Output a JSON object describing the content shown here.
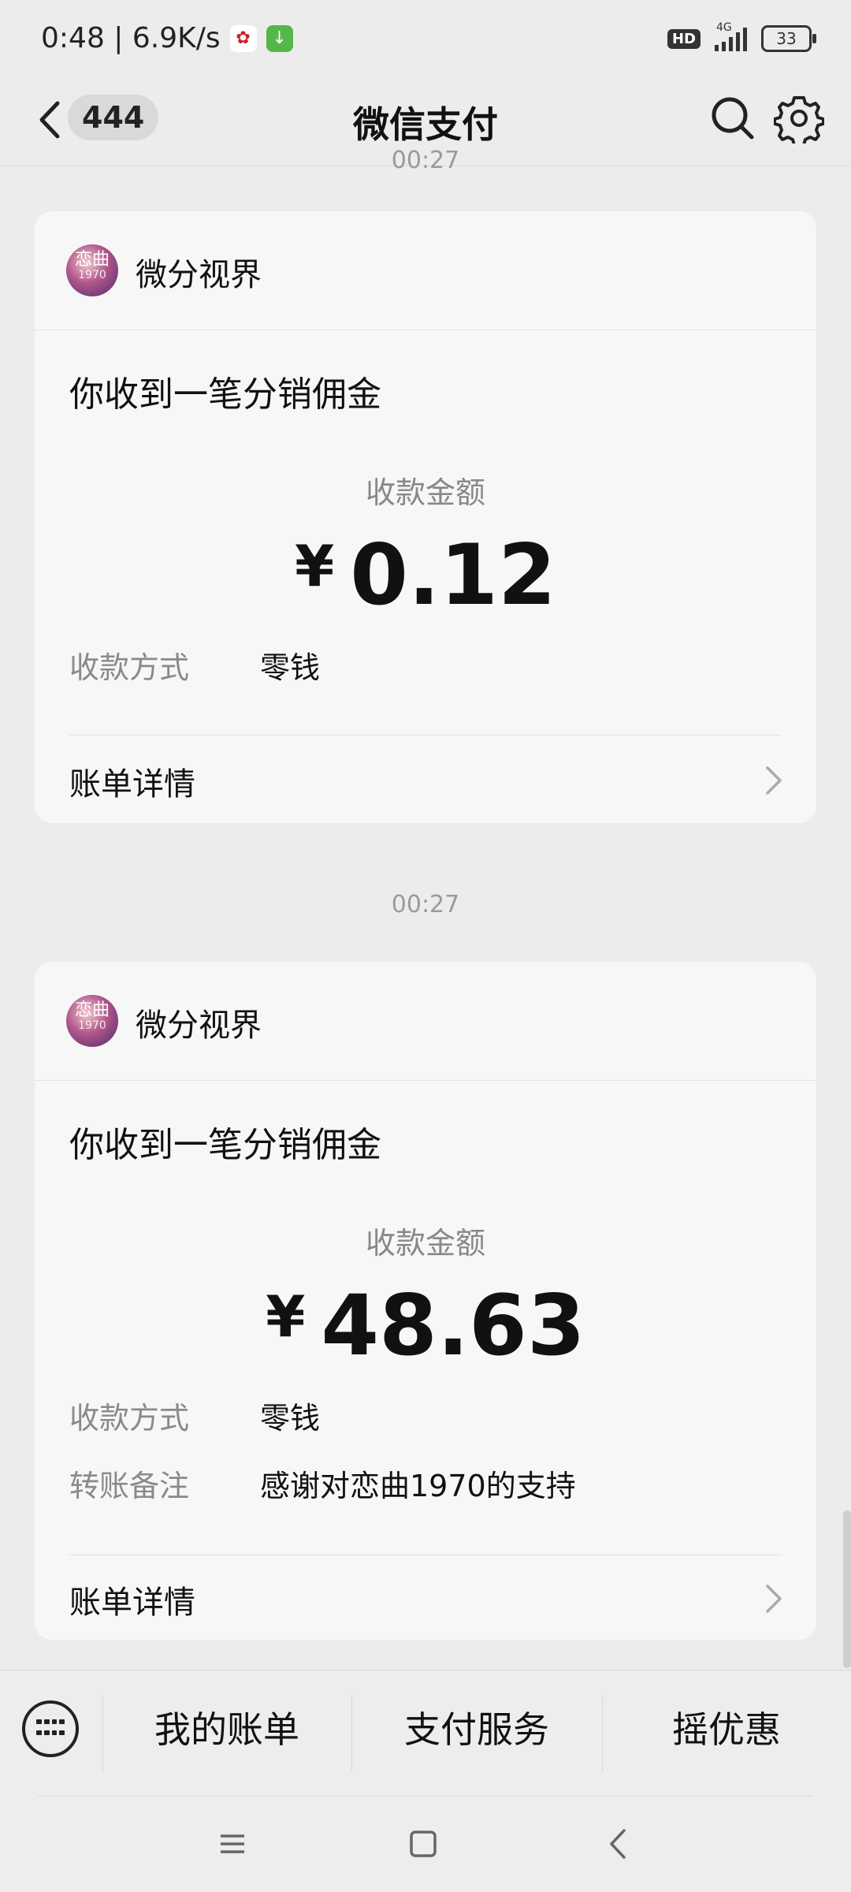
{
  "status_bar": {
    "time_speed": "0:48 | 6.9K/s",
    "hd": "HD",
    "network": "4G",
    "battery": "33"
  },
  "header": {
    "unread_count": "444",
    "title": "微信支付"
  },
  "clipped_timestamp": "00:27",
  "messages": [
    {
      "merchant": "微分视界",
      "avatar_text": "恋曲",
      "avatar_sub": "1970",
      "title": "你收到一笔分销佣金",
      "amount_label": "收款金额",
      "currency": "¥",
      "amount": "0.12",
      "method_label": "收款方式",
      "method_value": "零钱",
      "detail_label": "账单详情"
    },
    {
      "timestamp": "00:27",
      "merchant": "微分视界",
      "avatar_text": "恋曲",
      "avatar_sub": "1970",
      "title": "你收到一笔分销佣金",
      "amount_label": "收款金额",
      "currency": "¥",
      "amount": "48.63",
      "method_label": "收款方式",
      "method_value": "零钱",
      "note_label": "转账备注",
      "note_value": "感谢对恋曲1970的支持",
      "detail_label": "账单详情"
    }
  ],
  "bottom_bar": {
    "item1": "我的账单",
    "item2": "支付服务",
    "item3": "摇优惠"
  },
  "icons": {
    "back": "back-arrow-icon",
    "search": "search-icon",
    "settings": "gear-icon",
    "keyboard": "keyboard-icon",
    "chevron": "chevron-right-icon",
    "nav_menu": "menu-icon",
    "nav_home": "home-icon",
    "nav_back": "back-icon"
  }
}
